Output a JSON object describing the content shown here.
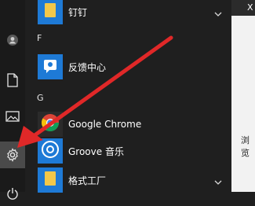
{
  "rail": {
    "items": [
      {
        "name": "user-icon"
      },
      {
        "name": "document-icon"
      },
      {
        "name": "pictures-icon"
      },
      {
        "name": "settings-icon",
        "active": true
      },
      {
        "name": "power-icon"
      }
    ]
  },
  "app_list": {
    "groups": [
      {
        "letter": "F"
      },
      {
        "letter": "G"
      }
    ],
    "apps": [
      {
        "label": "钉钉",
        "icon": "folder-icon",
        "color": "#1e7ad6",
        "expandable": true
      },
      {
        "label": "反馈中心",
        "icon": "feedback-hub-icon",
        "color": "#1e7ad6",
        "expandable": false
      },
      {
        "label": "Google Chrome",
        "icon": "chrome-icon",
        "color": "#2a2a2a",
        "expandable": false
      },
      {
        "label": "Groove 音乐",
        "icon": "groove-music-icon",
        "color": "#1e7ad6",
        "expandable": false
      },
      {
        "label": "格式工厂",
        "icon": "folder-icon",
        "color": "#1e7ad6",
        "expandable": true
      }
    ]
  },
  "background": {
    "top_chip_text": "X",
    "side_text": "浏览"
  },
  "annotation": {
    "arrow_color": "#e02828"
  }
}
